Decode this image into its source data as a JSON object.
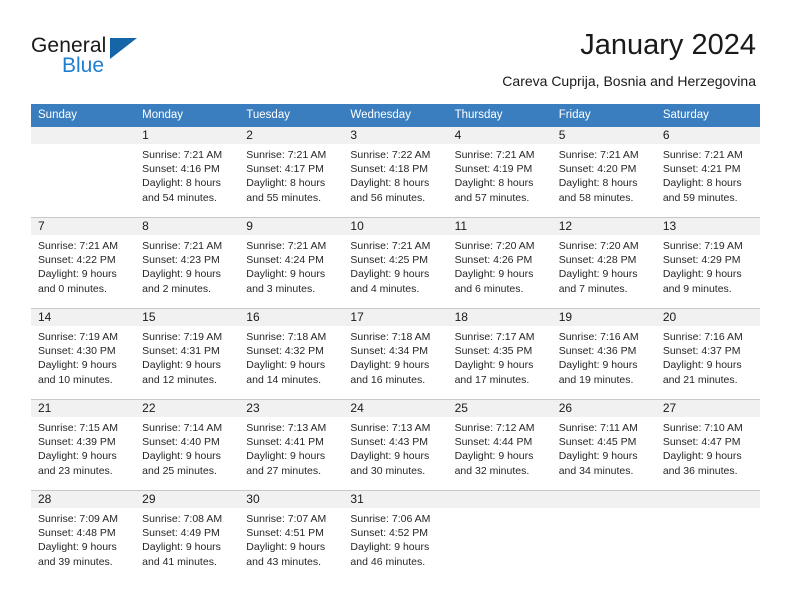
{
  "brand": {
    "line1": "General",
    "line2": "Blue",
    "triangle_color": "#1565a8",
    "blue_text_color": "#1e7fd0"
  },
  "header": {
    "title": "January 2024",
    "subtitle": "Careva Cuprija, Bosnia and Herzegovina"
  },
  "theme": {
    "header_row_bg": "#3b7ebf",
    "header_row_text": "#ffffff",
    "alt_row_bg": "#f8f8f8",
    "daynum_strip_bg": "#f1f1f1"
  },
  "weekday_headers": [
    "Sunday",
    "Monday",
    "Tuesday",
    "Wednesday",
    "Thursday",
    "Friday",
    "Saturday"
  ],
  "weeks": [
    [
      {
        "day": "",
        "sunrise": "",
        "sunset": "",
        "daylight_l1": "",
        "daylight_l2": ""
      },
      {
        "day": "1",
        "sunrise": "Sunrise: 7:21 AM",
        "sunset": "Sunset: 4:16 PM",
        "daylight_l1": "Daylight: 8 hours",
        "daylight_l2": "and 54 minutes."
      },
      {
        "day": "2",
        "sunrise": "Sunrise: 7:21 AM",
        "sunset": "Sunset: 4:17 PM",
        "daylight_l1": "Daylight: 8 hours",
        "daylight_l2": "and 55 minutes."
      },
      {
        "day": "3",
        "sunrise": "Sunrise: 7:22 AM",
        "sunset": "Sunset: 4:18 PM",
        "daylight_l1": "Daylight: 8 hours",
        "daylight_l2": "and 56 minutes."
      },
      {
        "day": "4",
        "sunrise": "Sunrise: 7:21 AM",
        "sunset": "Sunset: 4:19 PM",
        "daylight_l1": "Daylight: 8 hours",
        "daylight_l2": "and 57 minutes."
      },
      {
        "day": "5",
        "sunrise": "Sunrise: 7:21 AM",
        "sunset": "Sunset: 4:20 PM",
        "daylight_l1": "Daylight: 8 hours",
        "daylight_l2": "and 58 minutes."
      },
      {
        "day": "6",
        "sunrise": "Sunrise: 7:21 AM",
        "sunset": "Sunset: 4:21 PM",
        "daylight_l1": "Daylight: 8 hours",
        "daylight_l2": "and 59 minutes."
      }
    ],
    [
      {
        "day": "7",
        "sunrise": "Sunrise: 7:21 AM",
        "sunset": "Sunset: 4:22 PM",
        "daylight_l1": "Daylight: 9 hours",
        "daylight_l2": "and 0 minutes."
      },
      {
        "day": "8",
        "sunrise": "Sunrise: 7:21 AM",
        "sunset": "Sunset: 4:23 PM",
        "daylight_l1": "Daylight: 9 hours",
        "daylight_l2": "and 2 minutes."
      },
      {
        "day": "9",
        "sunrise": "Sunrise: 7:21 AM",
        "sunset": "Sunset: 4:24 PM",
        "daylight_l1": "Daylight: 9 hours",
        "daylight_l2": "and 3 minutes."
      },
      {
        "day": "10",
        "sunrise": "Sunrise: 7:21 AM",
        "sunset": "Sunset: 4:25 PM",
        "daylight_l1": "Daylight: 9 hours",
        "daylight_l2": "and 4 minutes."
      },
      {
        "day": "11",
        "sunrise": "Sunrise: 7:20 AM",
        "sunset": "Sunset: 4:26 PM",
        "daylight_l1": "Daylight: 9 hours",
        "daylight_l2": "and 6 minutes."
      },
      {
        "day": "12",
        "sunrise": "Sunrise: 7:20 AM",
        "sunset": "Sunset: 4:28 PM",
        "daylight_l1": "Daylight: 9 hours",
        "daylight_l2": "and 7 minutes."
      },
      {
        "day": "13",
        "sunrise": "Sunrise: 7:19 AM",
        "sunset": "Sunset: 4:29 PM",
        "daylight_l1": "Daylight: 9 hours",
        "daylight_l2": "and 9 minutes."
      }
    ],
    [
      {
        "day": "14",
        "sunrise": "Sunrise: 7:19 AM",
        "sunset": "Sunset: 4:30 PM",
        "daylight_l1": "Daylight: 9 hours",
        "daylight_l2": "and 10 minutes."
      },
      {
        "day": "15",
        "sunrise": "Sunrise: 7:19 AM",
        "sunset": "Sunset: 4:31 PM",
        "daylight_l1": "Daylight: 9 hours",
        "daylight_l2": "and 12 minutes."
      },
      {
        "day": "16",
        "sunrise": "Sunrise: 7:18 AM",
        "sunset": "Sunset: 4:32 PM",
        "daylight_l1": "Daylight: 9 hours",
        "daylight_l2": "and 14 minutes."
      },
      {
        "day": "17",
        "sunrise": "Sunrise: 7:18 AM",
        "sunset": "Sunset: 4:34 PM",
        "daylight_l1": "Daylight: 9 hours",
        "daylight_l2": "and 16 minutes."
      },
      {
        "day": "18",
        "sunrise": "Sunrise: 7:17 AM",
        "sunset": "Sunset: 4:35 PM",
        "daylight_l1": "Daylight: 9 hours",
        "daylight_l2": "and 17 minutes."
      },
      {
        "day": "19",
        "sunrise": "Sunrise: 7:16 AM",
        "sunset": "Sunset: 4:36 PM",
        "daylight_l1": "Daylight: 9 hours",
        "daylight_l2": "and 19 minutes."
      },
      {
        "day": "20",
        "sunrise": "Sunrise: 7:16 AM",
        "sunset": "Sunset: 4:37 PM",
        "daylight_l1": "Daylight: 9 hours",
        "daylight_l2": "and 21 minutes."
      }
    ],
    [
      {
        "day": "21",
        "sunrise": "Sunrise: 7:15 AM",
        "sunset": "Sunset: 4:39 PM",
        "daylight_l1": "Daylight: 9 hours",
        "daylight_l2": "and 23 minutes."
      },
      {
        "day": "22",
        "sunrise": "Sunrise: 7:14 AM",
        "sunset": "Sunset: 4:40 PM",
        "daylight_l1": "Daylight: 9 hours",
        "daylight_l2": "and 25 minutes."
      },
      {
        "day": "23",
        "sunrise": "Sunrise: 7:13 AM",
        "sunset": "Sunset: 4:41 PM",
        "daylight_l1": "Daylight: 9 hours",
        "daylight_l2": "and 27 minutes."
      },
      {
        "day": "24",
        "sunrise": "Sunrise: 7:13 AM",
        "sunset": "Sunset: 4:43 PM",
        "daylight_l1": "Daylight: 9 hours",
        "daylight_l2": "and 30 minutes."
      },
      {
        "day": "25",
        "sunrise": "Sunrise: 7:12 AM",
        "sunset": "Sunset: 4:44 PM",
        "daylight_l1": "Daylight: 9 hours",
        "daylight_l2": "and 32 minutes."
      },
      {
        "day": "26",
        "sunrise": "Sunrise: 7:11 AM",
        "sunset": "Sunset: 4:45 PM",
        "daylight_l1": "Daylight: 9 hours",
        "daylight_l2": "and 34 minutes."
      },
      {
        "day": "27",
        "sunrise": "Sunrise: 7:10 AM",
        "sunset": "Sunset: 4:47 PM",
        "daylight_l1": "Daylight: 9 hours",
        "daylight_l2": "and 36 minutes."
      }
    ],
    [
      {
        "day": "28",
        "sunrise": "Sunrise: 7:09 AM",
        "sunset": "Sunset: 4:48 PM",
        "daylight_l1": "Daylight: 9 hours",
        "daylight_l2": "and 39 minutes."
      },
      {
        "day": "29",
        "sunrise": "Sunrise: 7:08 AM",
        "sunset": "Sunset: 4:49 PM",
        "daylight_l1": "Daylight: 9 hours",
        "daylight_l2": "and 41 minutes."
      },
      {
        "day": "30",
        "sunrise": "Sunrise: 7:07 AM",
        "sunset": "Sunset: 4:51 PM",
        "daylight_l1": "Daylight: 9 hours",
        "daylight_l2": "and 43 minutes."
      },
      {
        "day": "31",
        "sunrise": "Sunrise: 7:06 AM",
        "sunset": "Sunset: 4:52 PM",
        "daylight_l1": "Daylight: 9 hours",
        "daylight_l2": "and 46 minutes."
      },
      {
        "day": "",
        "sunrise": "",
        "sunset": "",
        "daylight_l1": "",
        "daylight_l2": ""
      },
      {
        "day": "",
        "sunrise": "",
        "sunset": "",
        "daylight_l1": "",
        "daylight_l2": ""
      },
      {
        "day": "",
        "sunrise": "",
        "sunset": "",
        "daylight_l1": "",
        "daylight_l2": ""
      }
    ]
  ]
}
